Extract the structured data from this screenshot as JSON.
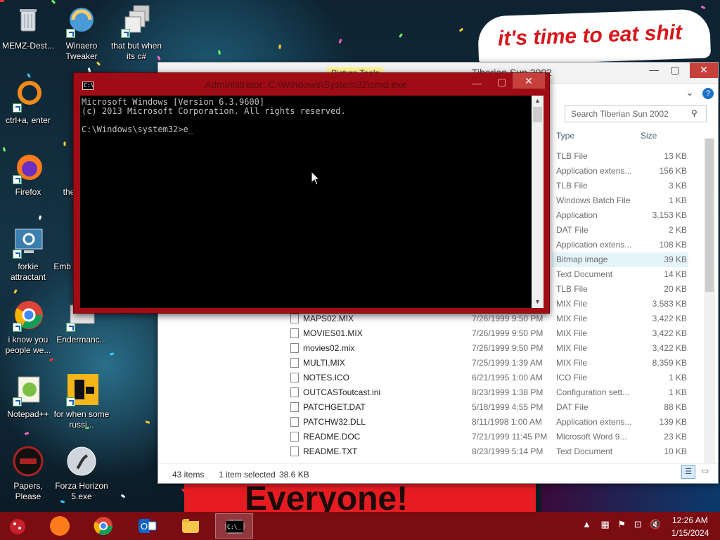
{
  "desktop": {
    "banner_text": "it's time to eat shit",
    "sign_text": "Everyone!",
    "icons": [
      {
        "label": "MEMZ-Dest..."
      },
      {
        "label": "Winaero Tweaker"
      },
      {
        "label": "that but when its c#"
      },
      {
        "label": "ctrl+a, enter"
      },
      {
        "label": "Firefox"
      },
      {
        "label": "the"
      },
      {
        "label": "forkie attractant"
      },
      {
        "label": "Emb De"
      },
      {
        "label": "i know you people we..."
      },
      {
        "label": "Endermanc..."
      },
      {
        "label": "Notepad++"
      },
      {
        "label": "for when some russi..."
      },
      {
        "label": "Papers, Please"
      },
      {
        "label": "Forza Horizon 5.exe"
      }
    ]
  },
  "cmd": {
    "title": "Administrator: C:\\Windows\\System32\\cmd.exe",
    "line1": "Microsoft Windows [Version 6.3.9600]",
    "line2": "(c) 2013 Microsoft Corporation. All rights reserved.",
    "line3": "",
    "prompt": "C:\\Windows\\system32>e",
    "close_label": "✕",
    "min_label": "—",
    "max_label": "▢"
  },
  "explorer": {
    "title": "Tiberian Sun 2002",
    "ribbon_tab": "Picture Tools",
    "search_placeholder": "Search Tiberian Sun 2002",
    "col_type": "Type",
    "col_size": "Size",
    "top_rows": [
      {
        "type": "TLB File",
        "size": "13 KB"
      },
      {
        "type": "Application extens...",
        "size": "156 KB"
      },
      {
        "type": "TLB File",
        "size": "3 KB"
      },
      {
        "type": "Windows Batch File",
        "size": "1 KB"
      },
      {
        "type": "Application",
        "size": "3,153 KB"
      },
      {
        "type": "DAT File",
        "size": "2 KB"
      },
      {
        "type": "Application extens...",
        "size": "108 KB"
      },
      {
        "type": "Bitmap image",
        "size": "39 KB",
        "selected": true
      },
      {
        "type": "Text Document",
        "size": "14 KB"
      },
      {
        "type": "TLB File",
        "size": "20 KB"
      },
      {
        "type": "MIX File",
        "size": "3,583 KB"
      }
    ],
    "rows": [
      {
        "name": "MAPS02.MIX",
        "date": "7/26/1999 9:50 PM",
        "type": "MIX File",
        "size": "3,422 KB"
      },
      {
        "name": "MOVIES01.MIX",
        "date": "7/26/1999 9:50 PM",
        "type": "MIX File",
        "size": "3,422 KB"
      },
      {
        "name": "movies02.mix",
        "date": "7/26/1999 9:50 PM",
        "type": "MIX File",
        "size": "3,422 KB"
      },
      {
        "name": "MULTI.MIX",
        "date": "7/25/1999 1:39 AM",
        "type": "MIX File",
        "size": "8,359 KB"
      },
      {
        "name": "NOTES.ICO",
        "date": "6/21/1995 1:00 AM",
        "type": "ICO File",
        "size": "1 KB"
      },
      {
        "name": "OUTCASToutcast.ini",
        "date": "8/23/1999 1:38 PM",
        "type": "Configuration sett...",
        "size": "1 KB"
      },
      {
        "name": "PATCHGET.DAT",
        "date": "5/18/1999 4:55 PM",
        "type": "DAT File",
        "size": "88 KB"
      },
      {
        "name": "PATCHW32.DLL",
        "date": "8/11/1998 1:00 AM",
        "type": "Application extens...",
        "size": "139 KB"
      },
      {
        "name": "README.DOC",
        "date": "7/21/1999 11:45 PM",
        "type": "Microsoft Word 9...",
        "size": "23 KB"
      },
      {
        "name": "README.TXT",
        "date": "8/23/1999 5:14 PM",
        "type": "Text Document",
        "size": "10 KB"
      }
    ],
    "status_items": "43 items",
    "status_selected": "1 item selected",
    "status_size": "38.6 KB"
  },
  "taskbar": {
    "time": "12:26 AM",
    "date": "1/15/2024",
    "colors": {
      "bar": "#7a0c12",
      "cmd_frame": "#a00c15"
    }
  }
}
